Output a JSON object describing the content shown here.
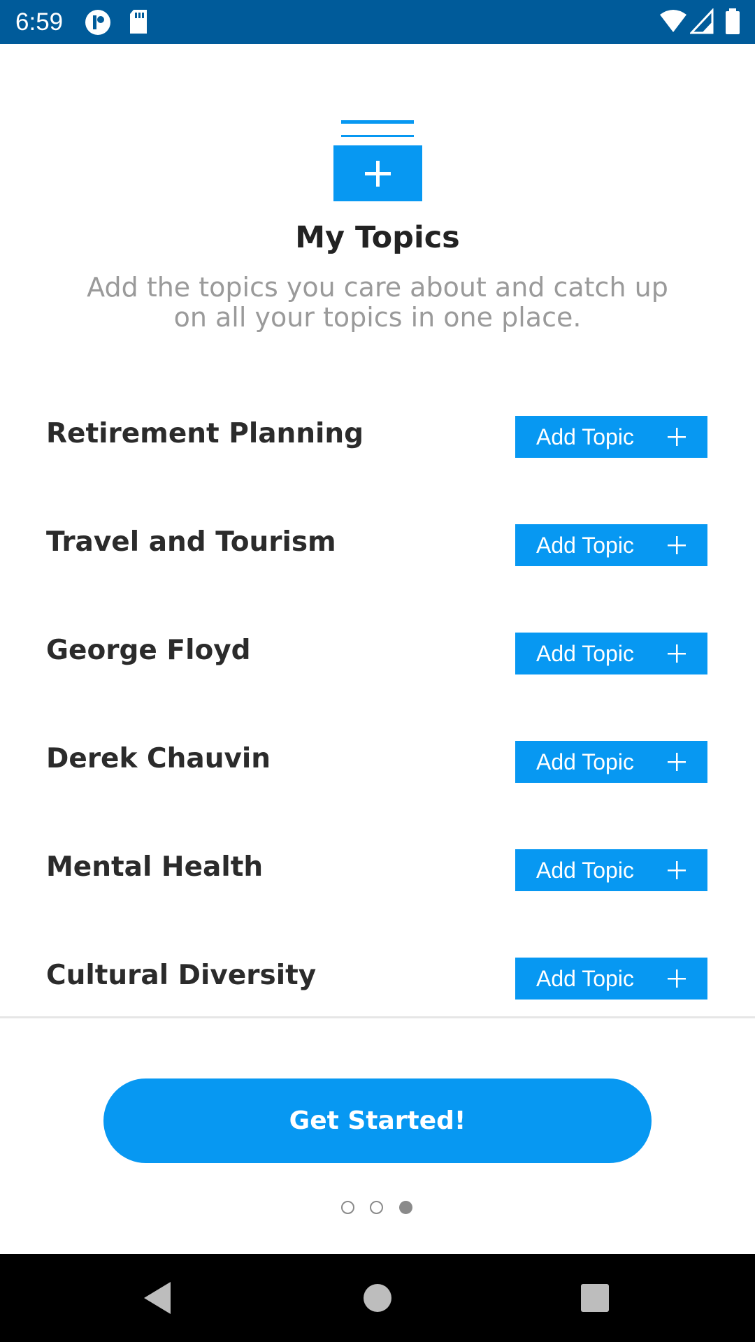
{
  "status_bar": {
    "time": "6:59",
    "icons": [
      "notification-app-icon",
      "sd-card-icon",
      "wifi-icon",
      "cell-signal-icon",
      "battery-icon"
    ],
    "background_color": "#005b9a"
  },
  "header": {
    "icon": "topics-add-icon",
    "title": "My Topics",
    "subtitle_line1": "Add the topics you care about and catch up",
    "subtitle_line2": "on all your topics in one place."
  },
  "topics": [
    {
      "name": "Retirement Planning",
      "button_label": "Add Topic"
    },
    {
      "name": "Travel and Tourism",
      "button_label": "Add Topic"
    },
    {
      "name": "George Floyd",
      "button_label": "Add Topic"
    },
    {
      "name": "Derek Chauvin",
      "button_label": "Add Topic"
    },
    {
      "name": "Mental Health",
      "button_label": "Add Topic"
    },
    {
      "name": "Cultural Diversity",
      "button_label": "Add Topic"
    }
  ],
  "get_started": {
    "label": "Get Started!"
  },
  "page_indicator": {
    "total": 3,
    "active_index": 2
  },
  "nav_bar": {
    "icons": [
      "back-icon",
      "home-icon",
      "recents-icon"
    ]
  },
  "colors": {
    "accent": "#0798f2",
    "title_text": "#222222",
    "subtitle_text": "#9a9a9a"
  }
}
